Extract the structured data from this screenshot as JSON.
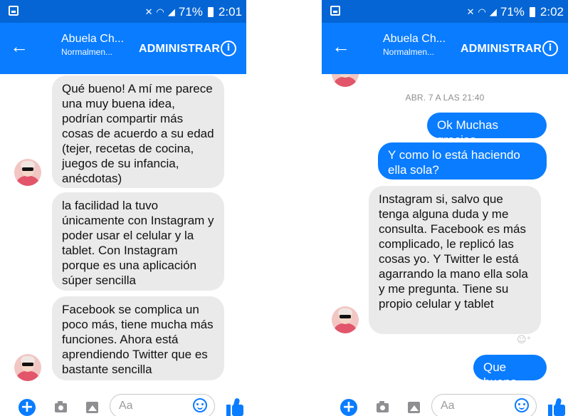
{
  "colors": {
    "status_bar": "#0565d4",
    "header": "#0a7cff",
    "incoming_bubble": "#eaeaea",
    "outgoing_bubble": "#0a7cff"
  },
  "screens": [
    {
      "status": {
        "battery": "71%",
        "time": "2:01"
      },
      "header": {
        "back_icon": "arrow-left-icon",
        "contact_name": "Abuela Ch...",
        "contact_status": "Normalmen...",
        "action_label": "ADMINISTRAR",
        "info_icon": "info-icon"
      },
      "messages": [
        {
          "direction": "incoming",
          "text": "Qué bueno! A mí me parece una muy buena idea, podrían compartir más cosas de acuerdo a su edad (tejer, recetas de cocina, juegos de su infancia, anécdotas)"
        },
        {
          "direction": "incoming",
          "text": "la facilidad la tuvo únicamente con Instagram y poder usar el celular y la tablet. Con Instagram porque es una aplicación súper sencilla"
        },
        {
          "direction": "incoming",
          "text": "Facebook se complica un poco más, tiene mucha más funciones. Ahora está aprendiendo Twitter que es bastante sencilla"
        }
      ],
      "composer": {
        "placeholder": "Aa",
        "icons": [
          "plus-icon",
          "camera-icon",
          "gallery-icon",
          "emoji-icon",
          "like-icon"
        ]
      }
    },
    {
      "status": {
        "battery": "71%",
        "time": "2:02"
      },
      "header": {
        "back_icon": "arrow-left-icon",
        "contact_name": "Abuela Ch...",
        "contact_status": "Normalmen...",
        "action_label": "ADMINISTRAR",
        "info_icon": "info-icon"
      },
      "timestamp": "ABR. 7 A LAS 21:40",
      "messages": [
        {
          "direction": "outgoing",
          "text": "Ok Muchas gracias"
        },
        {
          "direction": "outgoing",
          "text": "Y como lo está haciendo ella sola?"
        },
        {
          "direction": "incoming",
          "text": "Instagram si, salvo que tenga alguna duda y me consulta. Facebook es más complicado, le replicó las cosas yo. Y Twitter le está agarrando la mano ella sola y me pregunta. Tiene su propio celular y tablet"
        },
        {
          "direction": "outgoing",
          "text": "Que buena"
        }
      ],
      "composer": {
        "placeholder": "Aa",
        "icons": [
          "plus-icon",
          "camera-icon",
          "gallery-icon",
          "emoji-icon",
          "like-icon"
        ]
      }
    }
  ]
}
